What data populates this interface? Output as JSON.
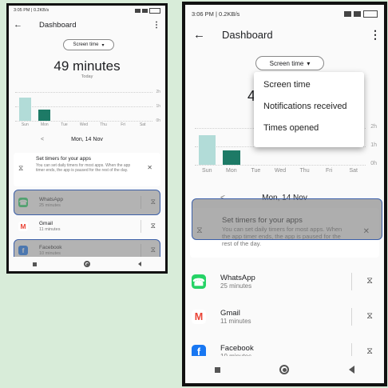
{
  "status": {
    "small_text": "3:05 PM | 0.2KB/s",
    "large_text": "3:06 PM | 0.2KB/s",
    "icons_right": "signal-wifi-battery-icons"
  },
  "header": {
    "back_icon": "arrow-left-icon",
    "title": "Dashboard",
    "more_icon": "more-vert-icon"
  },
  "chip": {
    "label": "Screen time",
    "caret": "▾"
  },
  "summary": {
    "value": "49 minutes",
    "sub": "Today",
    "value_partial": "4"
  },
  "chart_data": {
    "type": "bar",
    "categories": [
      "Sun",
      "Mon",
      "Tue",
      "Wed",
      "Thu",
      "Fri",
      "Sat"
    ],
    "values": [
      1.6,
      0.8,
      0,
      0,
      0,
      0,
      0
    ],
    "selected_index": 1,
    "gridlines": [
      "2h",
      "1h",
      "0h"
    ],
    "ylim": [
      0,
      2
    ],
    "colors": {
      "default": "#b2dcd8",
      "selected": "#1d7a66"
    }
  },
  "date_nav": {
    "prev": "<",
    "date": "Mon, 14 Nov",
    "next": ">"
  },
  "timer_card": {
    "title": "Set timers for your apps",
    "body": "You can set daily timers for most apps. When the app timer ends, the app is paused for the rest of the day.",
    "close": "✕"
  },
  "apps": [
    {
      "name": "WhatsApp",
      "time": "25 minutes",
      "icon": "whatsapp-icon",
      "color": "#25d366"
    },
    {
      "name": "Gmail",
      "time": "11 minutes",
      "icon": "gmail-icon",
      "color": "#ea4335"
    },
    {
      "name": "Facebook",
      "time": "10 minutes",
      "icon": "facebook-icon",
      "color": "#1877f2"
    }
  ],
  "dropdown": {
    "items": [
      "Screen time",
      "Notifications received",
      "Times opened"
    ]
  },
  "timer_glyph": "⧖"
}
